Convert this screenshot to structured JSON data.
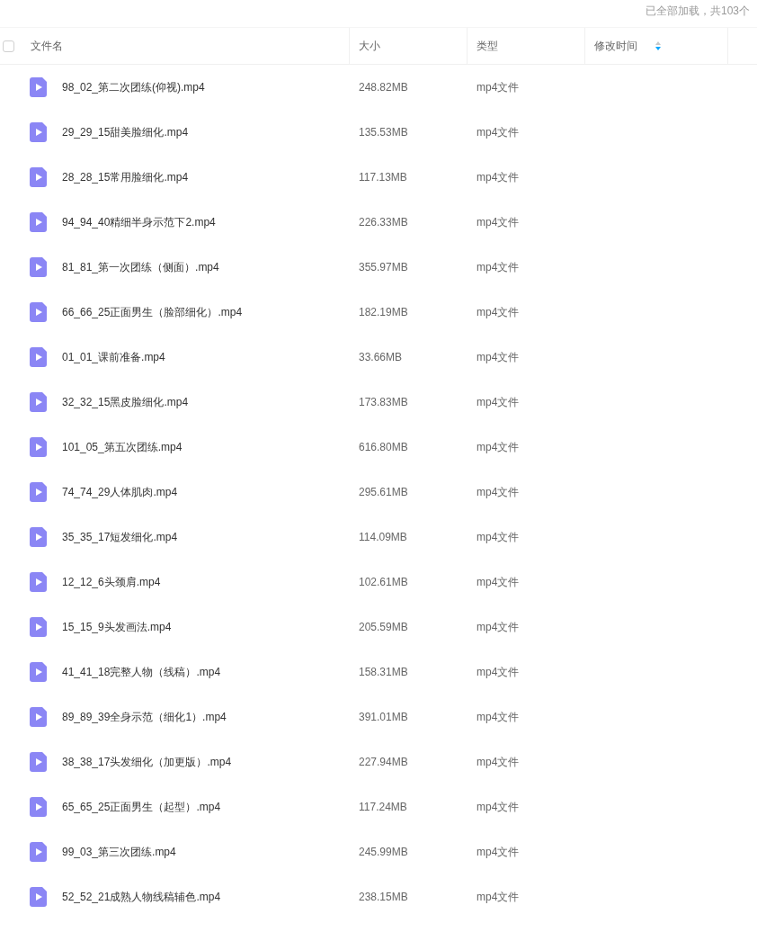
{
  "status": "已全部加载，共103个",
  "table": {
    "select_all": {
      "checked": false
    },
    "columns": [
      {
        "label": "文件名"
      },
      {
        "label": "大小"
      },
      {
        "label": "类型"
      },
      {
        "label": "修改时间",
        "sort_descending": true
      }
    ],
    "rows": [
      {
        "name": "98_02_第二次团练(仰视).mp4",
        "size": "248.82MB",
        "type": "mp4文件"
      },
      {
        "name": "29_29_15甜美脸细化.mp4",
        "size": "135.53MB",
        "type": "mp4文件"
      },
      {
        "name": "28_28_15常用脸细化.mp4",
        "size": "117.13MB",
        "type": "mp4文件"
      },
      {
        "name": "94_94_40精细半身示范下2.mp4",
        "size": "226.33MB",
        "type": "mp4文件"
      },
      {
        "name": "81_81_第一次团练（侧面）.mp4",
        "size": "355.97MB",
        "type": "mp4文件"
      },
      {
        "name": "66_66_25正面男生（脸部细化）.mp4",
        "size": "182.19MB",
        "type": "mp4文件"
      },
      {
        "name": "01_01_课前准备.mp4",
        "size": "33.66MB",
        "type": "mp4文件"
      },
      {
        "name": "32_32_15黑皮脸细化.mp4",
        "size": "173.83MB",
        "type": "mp4文件"
      },
      {
        "name": "101_05_第五次团练.mp4",
        "size": "616.80MB",
        "type": "mp4文件"
      },
      {
        "name": "74_74_29人体肌肉.mp4",
        "size": "295.61MB",
        "type": "mp4文件"
      },
      {
        "name": "35_35_17短发细化.mp4",
        "size": "114.09MB",
        "type": "mp4文件"
      },
      {
        "name": "12_12_6头颈肩.mp4",
        "size": "102.61MB",
        "type": "mp4文件"
      },
      {
        "name": "15_15_9头发画法.mp4",
        "size": "205.59MB",
        "type": "mp4文件"
      },
      {
        "name": "41_41_18完整人物（线稿）.mp4",
        "size": "158.31MB",
        "type": "mp4文件"
      },
      {
        "name": "89_89_39全身示范（细化1）.mp4",
        "size": "391.01MB",
        "type": "mp4文件"
      },
      {
        "name": "38_38_17头发细化（加更版）.mp4",
        "size": "227.94MB",
        "type": "mp4文件"
      },
      {
        "name": "65_65_25正面男生（起型）.mp4",
        "size": "117.24MB",
        "type": "mp4文件"
      },
      {
        "name": "99_03_第三次团练.mp4",
        "size": "245.99MB",
        "type": "mp4文件"
      },
      {
        "name": "52_52_21成熟人物线稿辅色.mp4",
        "size": "238.15MB",
        "type": "mp4文件"
      }
    ]
  }
}
